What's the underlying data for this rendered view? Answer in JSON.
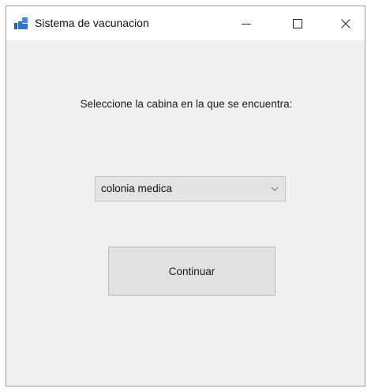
{
  "window": {
    "title": "Sistema de vacunacion",
    "icon": "app-window-icon",
    "controls": [
      "minimize-icon",
      "maximize-icon",
      "close-icon"
    ]
  },
  "form": {
    "prompt": "Seleccione la cabina en la que se encuentra:",
    "cabin_select": {
      "selected": "colonia medica",
      "icon": "chevron-down-icon"
    },
    "continue_label": "Continuar"
  },
  "colors": {
    "window_bg": "#f0f0f0",
    "titlebar_bg": "#ffffff",
    "button_bg": "#e1e1e1",
    "combo_bg": "#e3e3e3"
  }
}
